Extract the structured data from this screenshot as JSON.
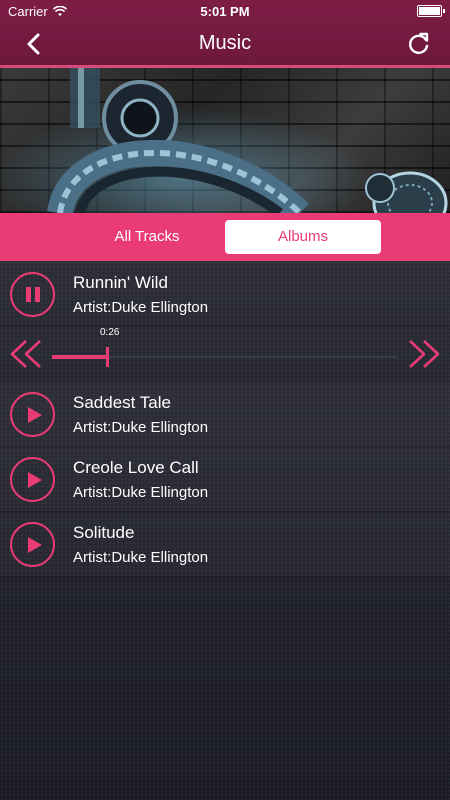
{
  "status": {
    "carrier": "Carrier",
    "time": "5:01 PM"
  },
  "nav": {
    "title": "Music",
    "back_icon": "chevron-left-icon",
    "refresh_icon": "refresh-icon"
  },
  "tabs": [
    {
      "label": "All Tracks",
      "selected": false
    },
    {
      "label": "Albums",
      "selected": true
    }
  ],
  "now_playing": {
    "title": "Runnin' Wild",
    "artist": "Artist:Duke Ellington",
    "elapsed": "0:26",
    "progress": 0.16,
    "state": "playing"
  },
  "tracks": [
    {
      "title": "Saddest Tale",
      "artist": "Artist:Duke Ellington"
    },
    {
      "title": "Creole Love Call",
      "artist": "Artist:Duke Ellington"
    },
    {
      "title": "Solitude",
      "artist": "Artist:Duke Ellington"
    }
  ],
  "colors": {
    "accent": "#ea3c74",
    "header": "#7d1d45"
  }
}
